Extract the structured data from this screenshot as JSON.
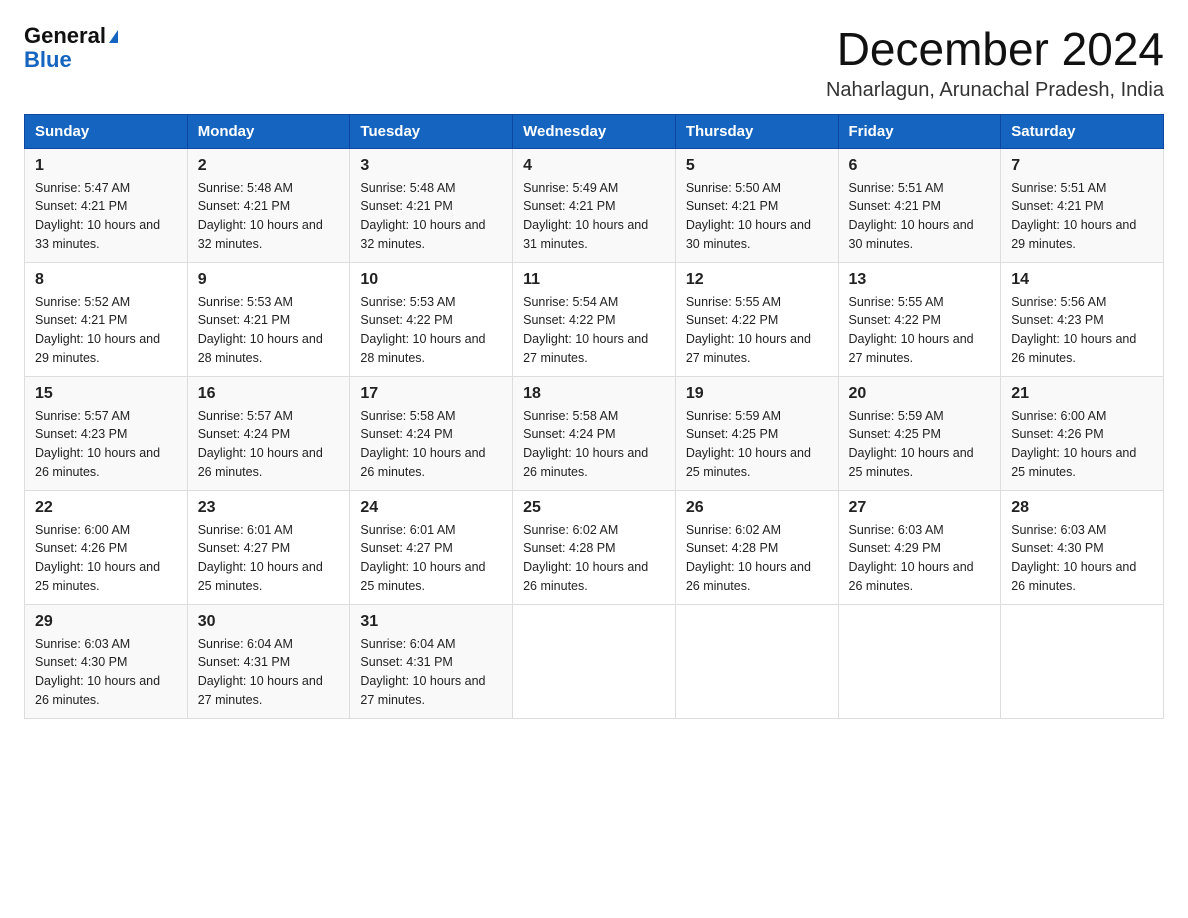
{
  "header": {
    "logo_line1": "General",
    "logo_line2": "Blue",
    "title": "December 2024",
    "subtitle": "Naharlagun, Arunachal Pradesh, India"
  },
  "columns": [
    "Sunday",
    "Monday",
    "Tuesday",
    "Wednesday",
    "Thursday",
    "Friday",
    "Saturday"
  ],
  "weeks": [
    [
      {
        "day": "1",
        "sunrise": "5:47 AM",
        "sunset": "4:21 PM",
        "daylight": "10 hours and 33 minutes."
      },
      {
        "day": "2",
        "sunrise": "5:48 AM",
        "sunset": "4:21 PM",
        "daylight": "10 hours and 32 minutes."
      },
      {
        "day": "3",
        "sunrise": "5:48 AM",
        "sunset": "4:21 PM",
        "daylight": "10 hours and 32 minutes."
      },
      {
        "day": "4",
        "sunrise": "5:49 AM",
        "sunset": "4:21 PM",
        "daylight": "10 hours and 31 minutes."
      },
      {
        "day": "5",
        "sunrise": "5:50 AM",
        "sunset": "4:21 PM",
        "daylight": "10 hours and 30 minutes."
      },
      {
        "day": "6",
        "sunrise": "5:51 AM",
        "sunset": "4:21 PM",
        "daylight": "10 hours and 30 minutes."
      },
      {
        "day": "7",
        "sunrise": "5:51 AM",
        "sunset": "4:21 PM",
        "daylight": "10 hours and 29 minutes."
      }
    ],
    [
      {
        "day": "8",
        "sunrise": "5:52 AM",
        "sunset": "4:21 PM",
        "daylight": "10 hours and 29 minutes."
      },
      {
        "day": "9",
        "sunrise": "5:53 AM",
        "sunset": "4:21 PM",
        "daylight": "10 hours and 28 minutes."
      },
      {
        "day": "10",
        "sunrise": "5:53 AM",
        "sunset": "4:22 PM",
        "daylight": "10 hours and 28 minutes."
      },
      {
        "day": "11",
        "sunrise": "5:54 AM",
        "sunset": "4:22 PM",
        "daylight": "10 hours and 27 minutes."
      },
      {
        "day": "12",
        "sunrise": "5:55 AM",
        "sunset": "4:22 PM",
        "daylight": "10 hours and 27 minutes."
      },
      {
        "day": "13",
        "sunrise": "5:55 AM",
        "sunset": "4:22 PM",
        "daylight": "10 hours and 27 minutes."
      },
      {
        "day": "14",
        "sunrise": "5:56 AM",
        "sunset": "4:23 PM",
        "daylight": "10 hours and 26 minutes."
      }
    ],
    [
      {
        "day": "15",
        "sunrise": "5:57 AM",
        "sunset": "4:23 PM",
        "daylight": "10 hours and 26 minutes."
      },
      {
        "day": "16",
        "sunrise": "5:57 AM",
        "sunset": "4:24 PM",
        "daylight": "10 hours and 26 minutes."
      },
      {
        "day": "17",
        "sunrise": "5:58 AM",
        "sunset": "4:24 PM",
        "daylight": "10 hours and 26 minutes."
      },
      {
        "day": "18",
        "sunrise": "5:58 AM",
        "sunset": "4:24 PM",
        "daylight": "10 hours and 26 minutes."
      },
      {
        "day": "19",
        "sunrise": "5:59 AM",
        "sunset": "4:25 PM",
        "daylight": "10 hours and 25 minutes."
      },
      {
        "day": "20",
        "sunrise": "5:59 AM",
        "sunset": "4:25 PM",
        "daylight": "10 hours and 25 minutes."
      },
      {
        "day": "21",
        "sunrise": "6:00 AM",
        "sunset": "4:26 PM",
        "daylight": "10 hours and 25 minutes."
      }
    ],
    [
      {
        "day": "22",
        "sunrise": "6:00 AM",
        "sunset": "4:26 PM",
        "daylight": "10 hours and 25 minutes."
      },
      {
        "day": "23",
        "sunrise": "6:01 AM",
        "sunset": "4:27 PM",
        "daylight": "10 hours and 25 minutes."
      },
      {
        "day": "24",
        "sunrise": "6:01 AM",
        "sunset": "4:27 PM",
        "daylight": "10 hours and 25 minutes."
      },
      {
        "day": "25",
        "sunrise": "6:02 AM",
        "sunset": "4:28 PM",
        "daylight": "10 hours and 26 minutes."
      },
      {
        "day": "26",
        "sunrise": "6:02 AM",
        "sunset": "4:28 PM",
        "daylight": "10 hours and 26 minutes."
      },
      {
        "day": "27",
        "sunrise": "6:03 AM",
        "sunset": "4:29 PM",
        "daylight": "10 hours and 26 minutes."
      },
      {
        "day": "28",
        "sunrise": "6:03 AM",
        "sunset": "4:30 PM",
        "daylight": "10 hours and 26 minutes."
      }
    ],
    [
      {
        "day": "29",
        "sunrise": "6:03 AM",
        "sunset": "4:30 PM",
        "daylight": "10 hours and 26 minutes."
      },
      {
        "day": "30",
        "sunrise": "6:04 AM",
        "sunset": "4:31 PM",
        "daylight": "10 hours and 27 minutes."
      },
      {
        "day": "31",
        "sunrise": "6:04 AM",
        "sunset": "4:31 PM",
        "daylight": "10 hours and 27 minutes."
      },
      null,
      null,
      null,
      null
    ]
  ],
  "labels": {
    "sunrise": "Sunrise:",
    "sunset": "Sunset:",
    "daylight": "Daylight:"
  }
}
